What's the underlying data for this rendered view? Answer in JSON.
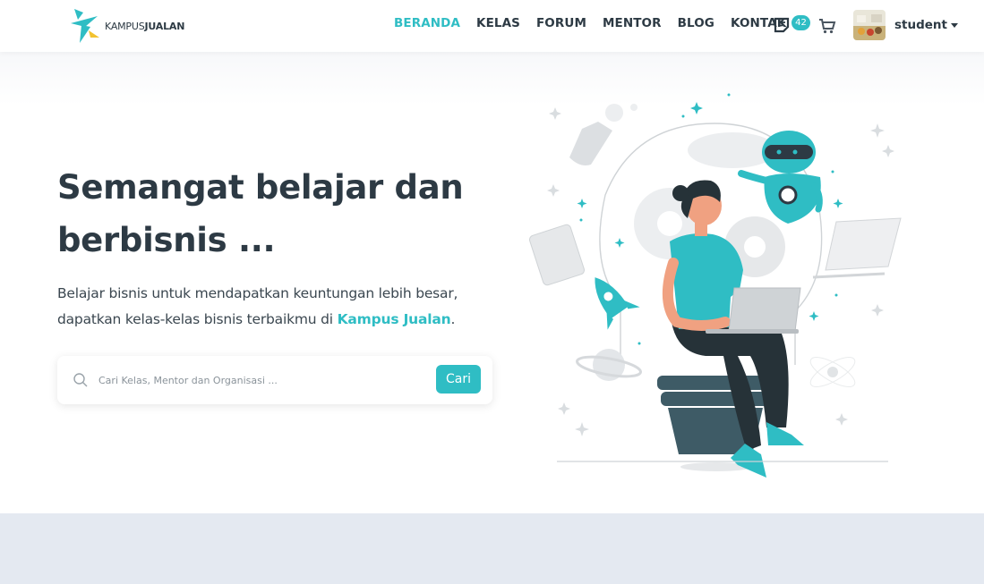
{
  "header": {
    "logo": {
      "word1": "KAMPUS",
      "word2": "JUALAN"
    },
    "nav": [
      {
        "label": "BERANDA",
        "active": true
      },
      {
        "label": "KELAS",
        "active": false
      },
      {
        "label": "FORUM",
        "active": false
      },
      {
        "label": "MENTOR",
        "active": false
      },
      {
        "label": "BLOG",
        "active": false
      },
      {
        "label": "KONTAK",
        "active": false
      }
    ],
    "notification_count": "42",
    "user_name": "student",
    "icons": [
      "notes-icon",
      "cart-icon",
      "chevron-down-icon"
    ]
  },
  "hero": {
    "title_line1": "Semangat belajar dan",
    "title_line2": "berbisnis ...",
    "desc_part1": "Belajar bisnis untuk mendapatkan keuntungan lebih besar, dapatkan kelas-kelas bisnis terbaikmu di ",
    "desc_brand": "Kampus Jualan",
    "desc_end": ".",
    "search_placeholder": "Cari Kelas, Mentor dan Organisasi ...",
    "search_button": "Cari"
  },
  "colors": {
    "accent": "#2fbdc4",
    "text": "#2d3a44",
    "band": "#e4e9f1"
  }
}
